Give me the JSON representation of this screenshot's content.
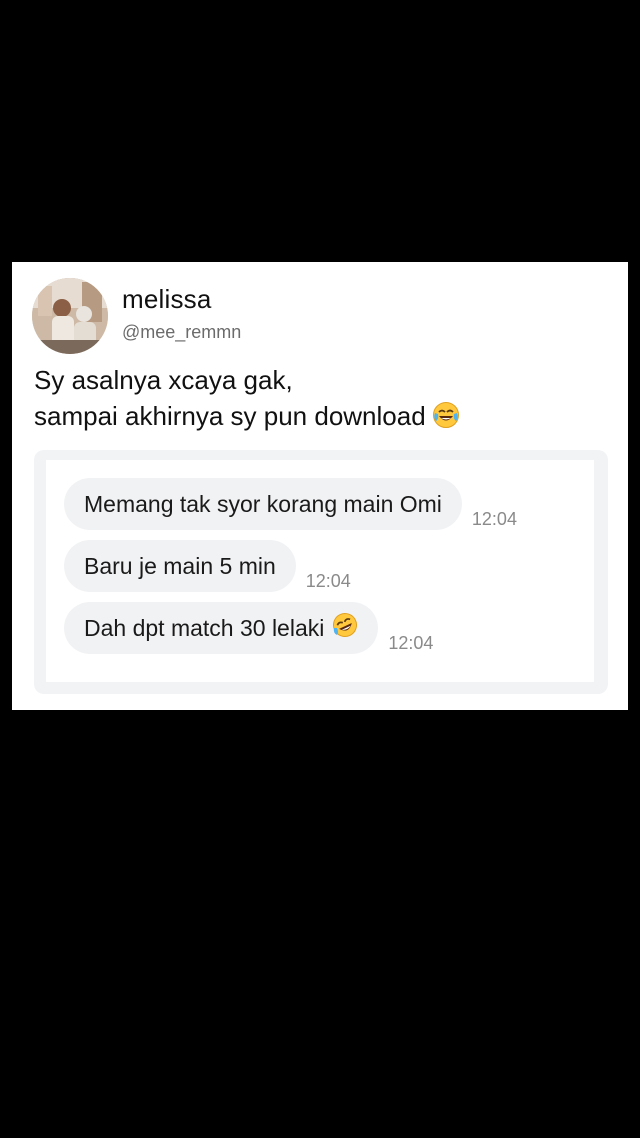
{
  "tweet": {
    "display_name": "melissa",
    "handle": "@mee_remmn",
    "text_line_1": "Sy asalnya xcaya gak,",
    "text_line_2": "sampai akhirnya sy pun download",
    "text_emoji": "face-with-tears-of-joy-icon"
  },
  "chat": {
    "messages": [
      {
        "text": "Memang tak syor korang main Omi",
        "time": "12:04"
      },
      {
        "text": "Baru je main 5 min",
        "time": "12:04"
      },
      {
        "text": "Dah dpt match 30 lelaki",
        "time": "12:04",
        "emoji": "rolling-on-floor-laughing-icon"
      }
    ]
  },
  "colors": {
    "background": "#000000",
    "card": "#ffffff",
    "bubble": "#f1f2f4",
    "timestamp": "#8a8a8a",
    "handle": "#6b6b6b"
  }
}
